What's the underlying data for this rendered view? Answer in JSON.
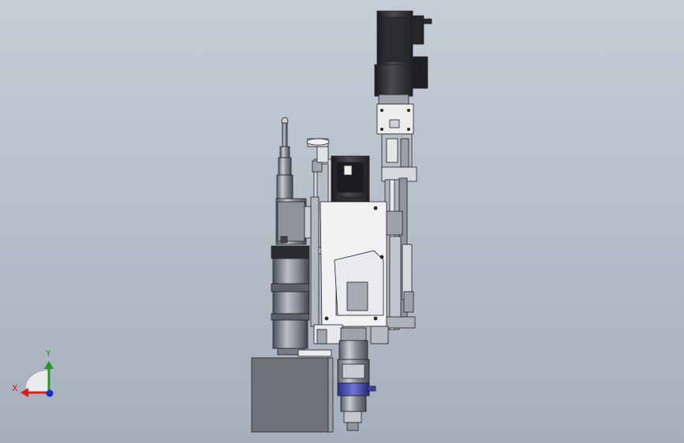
{
  "viewport": {
    "background_top": "#c4ccd6",
    "background_bottom": "#a7b0bd"
  },
  "model": {
    "icon": "mechanical-assembly-model"
  },
  "triad": {
    "x_label": "X",
    "y_label": "Y",
    "x_color": "#d42020",
    "y_color": "#1f9a2a",
    "z_color": "#1a2bd0"
  }
}
